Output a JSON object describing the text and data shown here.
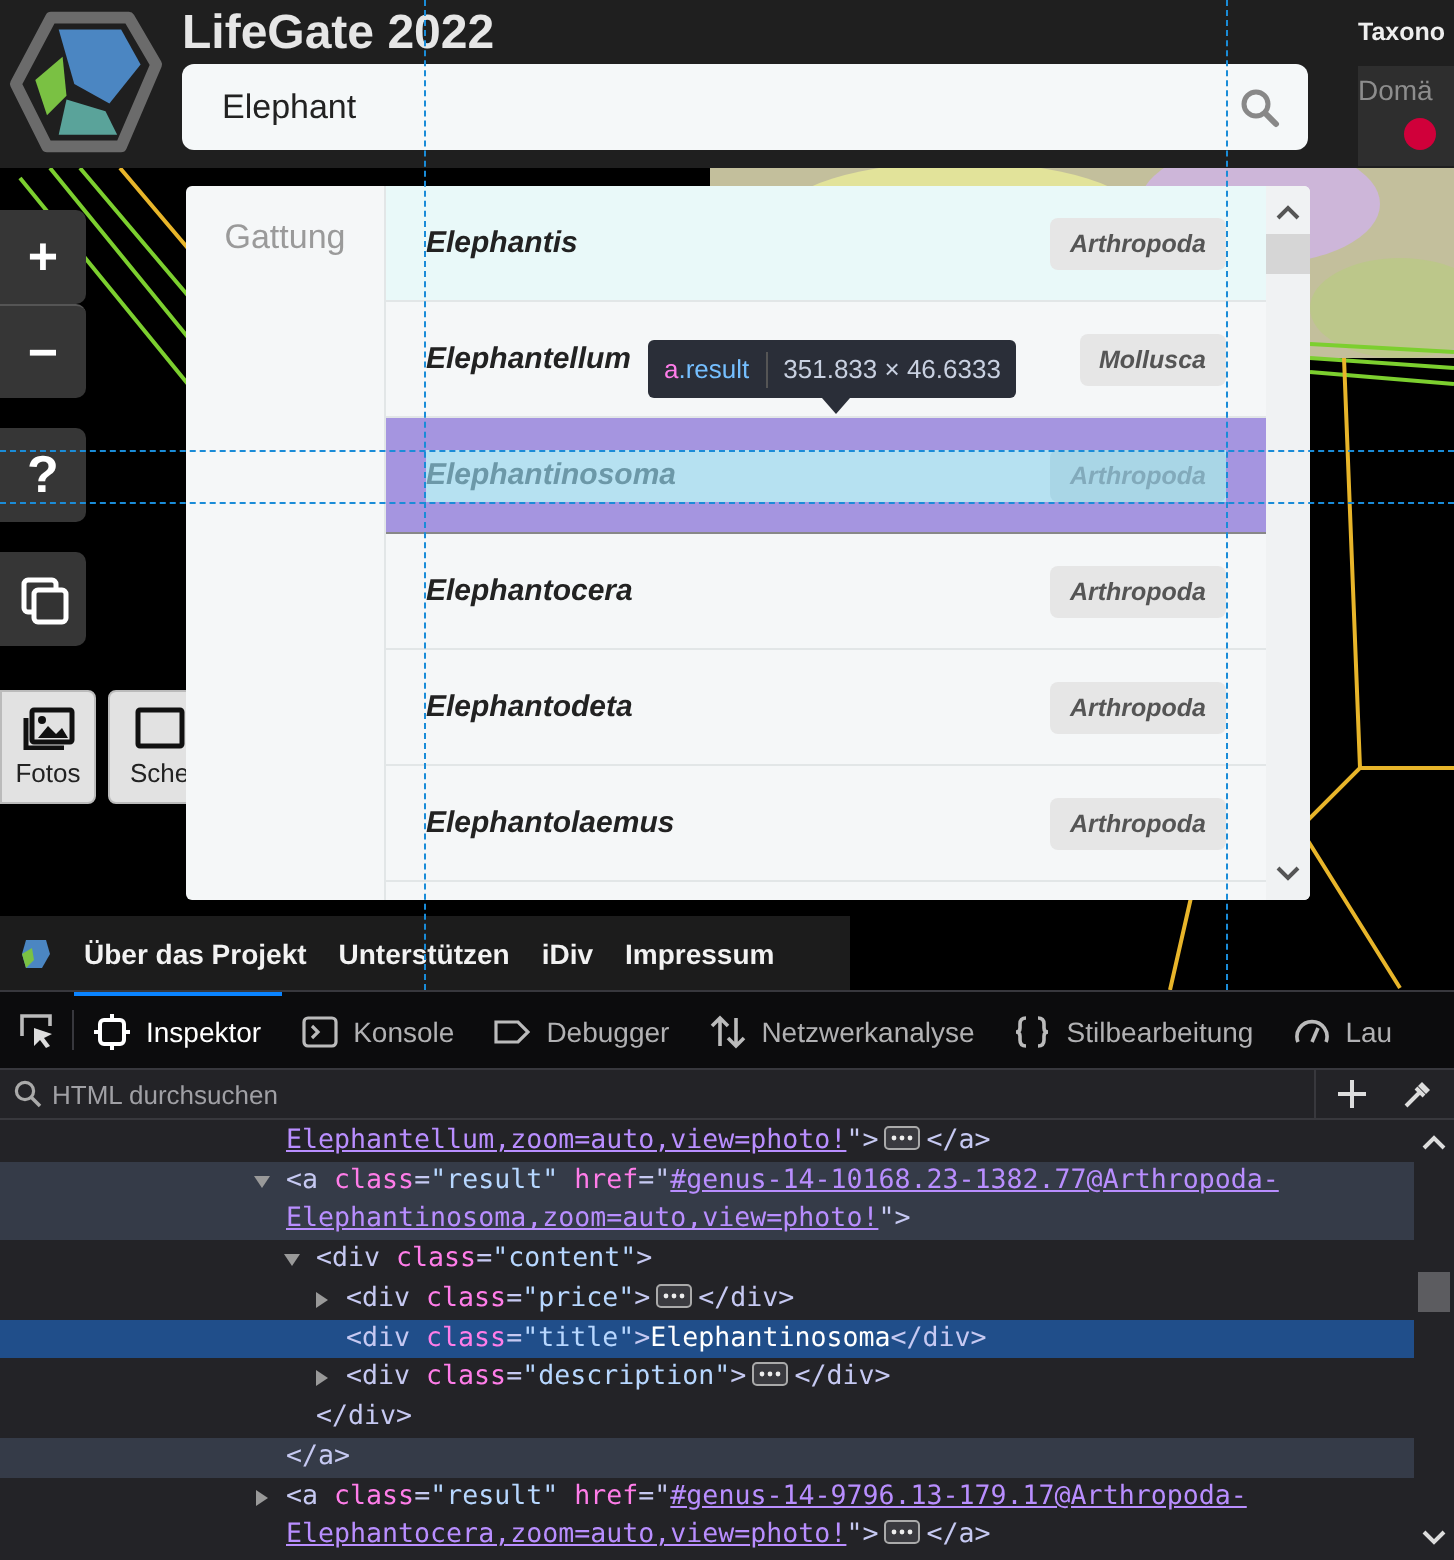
{
  "header": {
    "title": "LifeGate 2022",
    "search": {
      "value": "Elephant"
    },
    "panel_title": "Taxono",
    "panel_field": "Domä"
  },
  "map_controls": [
    {
      "kind": "text",
      "label": "+"
    },
    {
      "kind": "text",
      "label": "−"
    },
    {
      "kind": "text",
      "label": "?"
    },
    {
      "kind": "icon"
    }
  ],
  "view_buttons": [
    {
      "label": "Fotos"
    },
    {
      "label": "Sche"
    }
  ],
  "results": {
    "category": "Gattung",
    "rows": [
      {
        "name": "Elephantis",
        "phylum": "Arthropoda",
        "highlighted": true,
        "inspected": false
      },
      {
        "name": "Elephantellum",
        "phylum": "Mollusca",
        "highlighted": false,
        "inspected": false
      },
      {
        "name": "Elephantinosoma",
        "phylum": "Arthropoda",
        "highlighted": false,
        "inspected": true
      },
      {
        "name": "Elephantocera",
        "phylum": "Arthropoda",
        "highlighted": false,
        "inspected": false
      },
      {
        "name": "Elephantodeta",
        "phylum": "Arthropoda",
        "highlighted": false,
        "inspected": false
      },
      {
        "name": "Elephantolaemus",
        "phylum": "Arthropoda",
        "highlighted": false,
        "inspected": false
      }
    ]
  },
  "inspector_tooltip": {
    "tag": "a",
    "class": ".result",
    "size": "351.833 × 46.6333"
  },
  "footer_links": [
    "Über das Projekt",
    "Unterstützen",
    "iDiv",
    "Impressum"
  ],
  "devtools": {
    "tabs": [
      {
        "label": "Inspektor",
        "selected": true
      },
      {
        "label": "Konsole",
        "selected": false
      },
      {
        "label": "Debugger",
        "selected": false
      },
      {
        "label": "Netzwerkanalyse",
        "selected": false
      },
      {
        "label": "Stilbearbeitung",
        "selected": false
      },
      {
        "label": "Lau",
        "selected": false
      }
    ],
    "search": {
      "placeholder": "HTML durchsuchen"
    },
    "nodes": [
      {
        "kind": "tail",
        "hovered": false,
        "selected": false,
        "open": [
          {
            "kind": "link",
            "text": "Elephantellum,zoom=auto,view=photo!"
          },
          {
            "kind": "tag",
            "text": "\">"
          },
          {
            "kind": "more"
          },
          {
            "kind": "tag",
            "text": "</a>"
          }
        ]
      },
      {
        "kind": "expanded",
        "hovered": true,
        "selected": false,
        "open": [
          {
            "kind": "tag",
            "text": "<a"
          },
          {
            "kind": "attr",
            "text": " class"
          },
          {
            "kind": "tag",
            "text": "="
          },
          {
            "kind": "value",
            "text": "\"result\""
          },
          {
            "kind": "attr",
            "text": " href"
          },
          {
            "kind": "tag",
            "text": "=\""
          },
          {
            "kind": "link",
            "text": "#genus-14-10168.23-1382.77@Arthropoda-"
          },
          {
            "kind": "break"
          },
          {
            "kind": "link",
            "text": "Elephantinosoma,zoom=auto,view=photo!"
          },
          {
            "kind": "tag",
            "text": "\">"
          }
        ],
        "close": [
          {
            "kind": "tag",
            "text": "</a>"
          }
        ],
        "children": [
          {
            "kind": "expanded",
            "hovered": false,
            "selected": false,
            "open": [
              {
                "kind": "tag",
                "text": "<div"
              },
              {
                "kind": "attr",
                "text": " class"
              },
              {
                "kind": "tag",
                "text": "="
              },
              {
                "kind": "value",
                "text": "\"content\""
              },
              {
                "kind": "tag",
                "text": ">"
              }
            ],
            "close": [
              {
                "kind": "tag",
                "text": "</div>"
              }
            ],
            "children": [
              {
                "kind": "collapsed",
                "hovered": false,
                "selected": false,
                "open": [
                  {
                    "kind": "tag",
                    "text": "<div"
                  },
                  {
                    "kind": "attr",
                    "text": " class"
                  },
                  {
                    "kind": "tag",
                    "text": "="
                  },
                  {
                    "kind": "value",
                    "text": "\"price\""
                  },
                  {
                    "kind": "tag",
                    "text": ">"
                  },
                  {
                    "kind": "more"
                  },
                  {
                    "kind": "tag",
                    "text": "</div>"
                  }
                ]
              },
              {
                "kind": "leaf",
                "hovered": false,
                "selected": true,
                "open": [
                  {
                    "kind": "tag",
                    "text": "<div"
                  },
                  {
                    "kind": "attr",
                    "text": " class"
                  },
                  {
                    "kind": "tag",
                    "text": "="
                  },
                  {
                    "kind": "value",
                    "text": "\"title\""
                  },
                  {
                    "kind": "tag",
                    "text": ">"
                  },
                  {
                    "kind": "text",
                    "text": "Elephantinosoma"
                  },
                  {
                    "kind": "tag",
                    "text": "</div>"
                  }
                ]
              },
              {
                "kind": "collapsed",
                "hovered": false,
                "selected": false,
                "open": [
                  {
                    "kind": "tag",
                    "text": "<div"
                  },
                  {
                    "kind": "attr",
                    "text": " class"
                  },
                  {
                    "kind": "tag",
                    "text": "="
                  },
                  {
                    "kind": "value",
                    "text": "\"description\""
                  },
                  {
                    "kind": "tag",
                    "text": ">"
                  },
                  {
                    "kind": "more"
                  },
                  {
                    "kind": "tag",
                    "text": "</div>"
                  }
                ]
              }
            ]
          }
        ]
      },
      {
        "kind": "collapsed",
        "hovered": false,
        "selected": false,
        "open": [
          {
            "kind": "tag",
            "text": "<a"
          },
          {
            "kind": "attr",
            "text": " class"
          },
          {
            "kind": "tag",
            "text": "="
          },
          {
            "kind": "value",
            "text": "\"result\""
          },
          {
            "kind": "attr",
            "text": " href"
          },
          {
            "kind": "tag",
            "text": "=\""
          },
          {
            "kind": "link",
            "text": "#genus-14-9796.13-179.17@Arthropoda-"
          },
          {
            "kind": "break"
          },
          {
            "kind": "link",
            "text": "Elephantocera,zoom=auto,view=photo!"
          },
          {
            "kind": "tag",
            "text": "\">"
          },
          {
            "kind": "more"
          },
          {
            "kind": "tag",
            "text": "</a>"
          }
        ]
      }
    ]
  }
}
